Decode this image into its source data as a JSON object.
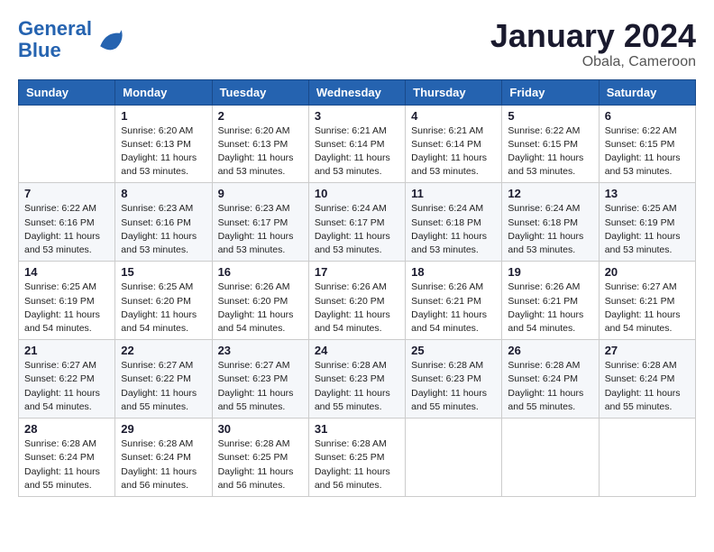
{
  "header": {
    "logo_line1": "General",
    "logo_line2": "Blue",
    "month": "January 2024",
    "location": "Obala, Cameroon"
  },
  "weekdays": [
    "Sunday",
    "Monday",
    "Tuesday",
    "Wednesday",
    "Thursday",
    "Friday",
    "Saturday"
  ],
  "weeks": [
    [
      {
        "day": "",
        "info": ""
      },
      {
        "day": "1",
        "info": "Sunrise: 6:20 AM\nSunset: 6:13 PM\nDaylight: 11 hours\nand 53 minutes."
      },
      {
        "day": "2",
        "info": "Sunrise: 6:20 AM\nSunset: 6:13 PM\nDaylight: 11 hours\nand 53 minutes."
      },
      {
        "day": "3",
        "info": "Sunrise: 6:21 AM\nSunset: 6:14 PM\nDaylight: 11 hours\nand 53 minutes."
      },
      {
        "day": "4",
        "info": "Sunrise: 6:21 AM\nSunset: 6:14 PM\nDaylight: 11 hours\nand 53 minutes."
      },
      {
        "day": "5",
        "info": "Sunrise: 6:22 AM\nSunset: 6:15 PM\nDaylight: 11 hours\nand 53 minutes."
      },
      {
        "day": "6",
        "info": "Sunrise: 6:22 AM\nSunset: 6:15 PM\nDaylight: 11 hours\nand 53 minutes."
      }
    ],
    [
      {
        "day": "7",
        "info": "Sunrise: 6:22 AM\nSunset: 6:16 PM\nDaylight: 11 hours\nand 53 minutes."
      },
      {
        "day": "8",
        "info": "Sunrise: 6:23 AM\nSunset: 6:16 PM\nDaylight: 11 hours\nand 53 minutes."
      },
      {
        "day": "9",
        "info": "Sunrise: 6:23 AM\nSunset: 6:17 PM\nDaylight: 11 hours\nand 53 minutes."
      },
      {
        "day": "10",
        "info": "Sunrise: 6:24 AM\nSunset: 6:17 PM\nDaylight: 11 hours\nand 53 minutes."
      },
      {
        "day": "11",
        "info": "Sunrise: 6:24 AM\nSunset: 6:18 PM\nDaylight: 11 hours\nand 53 minutes."
      },
      {
        "day": "12",
        "info": "Sunrise: 6:24 AM\nSunset: 6:18 PM\nDaylight: 11 hours\nand 53 minutes."
      },
      {
        "day": "13",
        "info": "Sunrise: 6:25 AM\nSunset: 6:19 PM\nDaylight: 11 hours\nand 53 minutes."
      }
    ],
    [
      {
        "day": "14",
        "info": "Sunrise: 6:25 AM\nSunset: 6:19 PM\nDaylight: 11 hours\nand 54 minutes."
      },
      {
        "day": "15",
        "info": "Sunrise: 6:25 AM\nSunset: 6:20 PM\nDaylight: 11 hours\nand 54 minutes."
      },
      {
        "day": "16",
        "info": "Sunrise: 6:26 AM\nSunset: 6:20 PM\nDaylight: 11 hours\nand 54 minutes."
      },
      {
        "day": "17",
        "info": "Sunrise: 6:26 AM\nSunset: 6:20 PM\nDaylight: 11 hours\nand 54 minutes."
      },
      {
        "day": "18",
        "info": "Sunrise: 6:26 AM\nSunset: 6:21 PM\nDaylight: 11 hours\nand 54 minutes."
      },
      {
        "day": "19",
        "info": "Sunrise: 6:26 AM\nSunset: 6:21 PM\nDaylight: 11 hours\nand 54 minutes."
      },
      {
        "day": "20",
        "info": "Sunrise: 6:27 AM\nSunset: 6:21 PM\nDaylight: 11 hours\nand 54 minutes."
      }
    ],
    [
      {
        "day": "21",
        "info": "Sunrise: 6:27 AM\nSunset: 6:22 PM\nDaylight: 11 hours\nand 54 minutes."
      },
      {
        "day": "22",
        "info": "Sunrise: 6:27 AM\nSunset: 6:22 PM\nDaylight: 11 hours\nand 55 minutes."
      },
      {
        "day": "23",
        "info": "Sunrise: 6:27 AM\nSunset: 6:23 PM\nDaylight: 11 hours\nand 55 minutes."
      },
      {
        "day": "24",
        "info": "Sunrise: 6:28 AM\nSunset: 6:23 PM\nDaylight: 11 hours\nand 55 minutes."
      },
      {
        "day": "25",
        "info": "Sunrise: 6:28 AM\nSunset: 6:23 PM\nDaylight: 11 hours\nand 55 minutes."
      },
      {
        "day": "26",
        "info": "Sunrise: 6:28 AM\nSunset: 6:24 PM\nDaylight: 11 hours\nand 55 minutes."
      },
      {
        "day": "27",
        "info": "Sunrise: 6:28 AM\nSunset: 6:24 PM\nDaylight: 11 hours\nand 55 minutes."
      }
    ],
    [
      {
        "day": "28",
        "info": "Sunrise: 6:28 AM\nSunset: 6:24 PM\nDaylight: 11 hours\nand 55 minutes."
      },
      {
        "day": "29",
        "info": "Sunrise: 6:28 AM\nSunset: 6:24 PM\nDaylight: 11 hours\nand 56 minutes."
      },
      {
        "day": "30",
        "info": "Sunrise: 6:28 AM\nSunset: 6:25 PM\nDaylight: 11 hours\nand 56 minutes."
      },
      {
        "day": "31",
        "info": "Sunrise: 6:28 AM\nSunset: 6:25 PM\nDaylight: 11 hours\nand 56 minutes."
      },
      {
        "day": "",
        "info": ""
      },
      {
        "day": "",
        "info": ""
      },
      {
        "day": "",
        "info": ""
      }
    ]
  ]
}
